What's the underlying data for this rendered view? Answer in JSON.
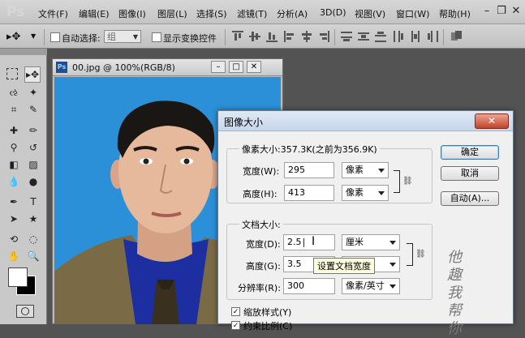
{
  "app": {
    "logo": "Ps",
    "menu": [
      "文件(F)",
      "编辑(E)",
      "图像(I)",
      "图层(L)",
      "选择(S)",
      "滤镜(T)",
      "分析(A)",
      "3D(D)",
      "视图(V)",
      "窗口(W)",
      "帮助(H)"
    ],
    "window_controls": {
      "minimize": "–",
      "restore": "❐",
      "close": "✕"
    }
  },
  "options_bar": {
    "auto_select_label": "自动选择:",
    "auto_select_value": "组",
    "show_transform_label": "显示变换控件"
  },
  "document": {
    "title": "00.jpg @ 100%(RGB/8)",
    "icon_text": "Ps",
    "btn_min": "–",
    "btn_max": "□",
    "btn_close": "✕"
  },
  "dialog": {
    "title": "图像大小",
    "close": "✕",
    "pixel_group_label": "像素大小:357.3K(之前为356.9K)",
    "pixel_width_label": "宽度(W):",
    "pixel_width_value": "295",
    "pixel_width_unit": "像素",
    "pixel_height_label": "高度(H):",
    "pixel_height_value": "413",
    "pixel_height_unit": "像素",
    "doc_group_label": "文档大小:",
    "doc_width_label": "宽度(D):",
    "doc_width_value": "2.5",
    "doc_width_unit": "厘米",
    "doc_height_label": "高度(G):",
    "doc_height_value": "3.5",
    "resolution_label": "分辨率(R):",
    "resolution_value": "300",
    "resolution_unit": "像素/英寸",
    "tooltip": "设置文档宽度",
    "ok": "确定",
    "cancel": "取消",
    "auto": "自动(A)...",
    "scale_styles_label": "缩放样式(Y)",
    "constrain_label": "约束比例(C)"
  },
  "watermark": "他 趣 我 帮 你"
}
